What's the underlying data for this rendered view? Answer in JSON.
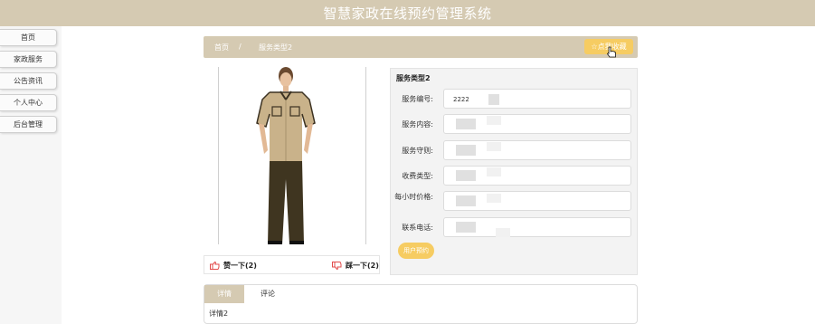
{
  "header": {
    "title": "智慧家政在线预约管理系统"
  },
  "sidebar": {
    "items": [
      {
        "label": "首页"
      },
      {
        "label": "家政服务"
      },
      {
        "label": "公告资讯"
      },
      {
        "label": "个人中心"
      },
      {
        "label": "后台管理"
      }
    ]
  },
  "breadcrumb": {
    "home": "首页",
    "separator": "/",
    "current": "服务类型2"
  },
  "favorite_button": {
    "label": "☆点我收藏"
  },
  "votes": {
    "like": "赞一下(2)",
    "dislike": "踩一下(2)"
  },
  "detail": {
    "title": "服务类型2",
    "fields": [
      {
        "label": "服务编号:",
        "value": "2222"
      },
      {
        "label": "服务内容:",
        "value": ""
      },
      {
        "label": "服务守则:",
        "value": ""
      },
      {
        "label": "收费类型:",
        "value": ""
      },
      {
        "label": "每小时价格:",
        "value": ""
      },
      {
        "label": "联系电话:",
        "value": ""
      }
    ],
    "book_button": "用户预约"
  },
  "tabs": [
    {
      "label": "详情"
    },
    {
      "label": "评论"
    }
  ],
  "tab_content": "详情2",
  "colors": {
    "accent": "#d5cab2",
    "button": "#f6cc62",
    "panel": "#f3f3f3"
  }
}
